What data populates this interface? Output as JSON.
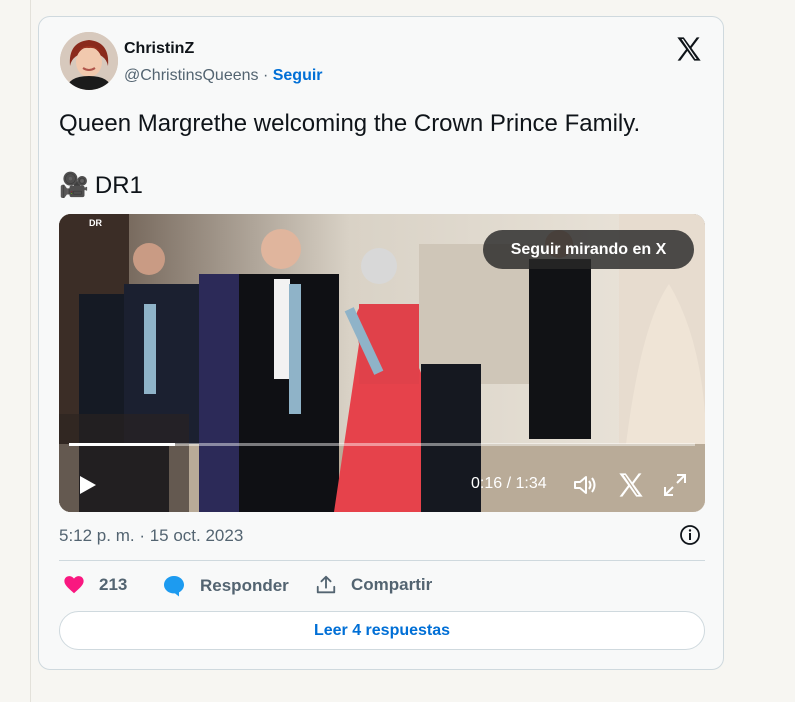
{
  "tweet": {
    "author_name": "ChristinZ",
    "handle": "@ChristinsQueens",
    "separator": " · ",
    "follow_label": "Seguir",
    "text": "Queen Margrethe welcoming the Crown Prince Family.",
    "camera_emoji": "🎥",
    "source": "DR1",
    "timestamp": "5:12 p. m. · 15 oct. 2023"
  },
  "video": {
    "watch_on_x_label": "Seguir mirando en X",
    "time_display": "0:16 / 1:34",
    "progress_fraction": 0.17,
    "channel_watermark": "DR"
  },
  "actions": {
    "likes_count": "213",
    "reply_label": "Responder",
    "share_label": "Compartir",
    "read_replies_label": "Leer 4 respuestas"
  },
  "colors": {
    "like": "#f91880",
    "reply": "#1d9bf0",
    "link": "#006fd6",
    "muted": "#536471"
  },
  "icons": [
    "x-logo-icon",
    "camera-icon",
    "play-icon",
    "volume-icon",
    "x-icon",
    "fullscreen-icon",
    "info-icon",
    "heart-icon",
    "reply-bubble-icon",
    "share-icon"
  ]
}
